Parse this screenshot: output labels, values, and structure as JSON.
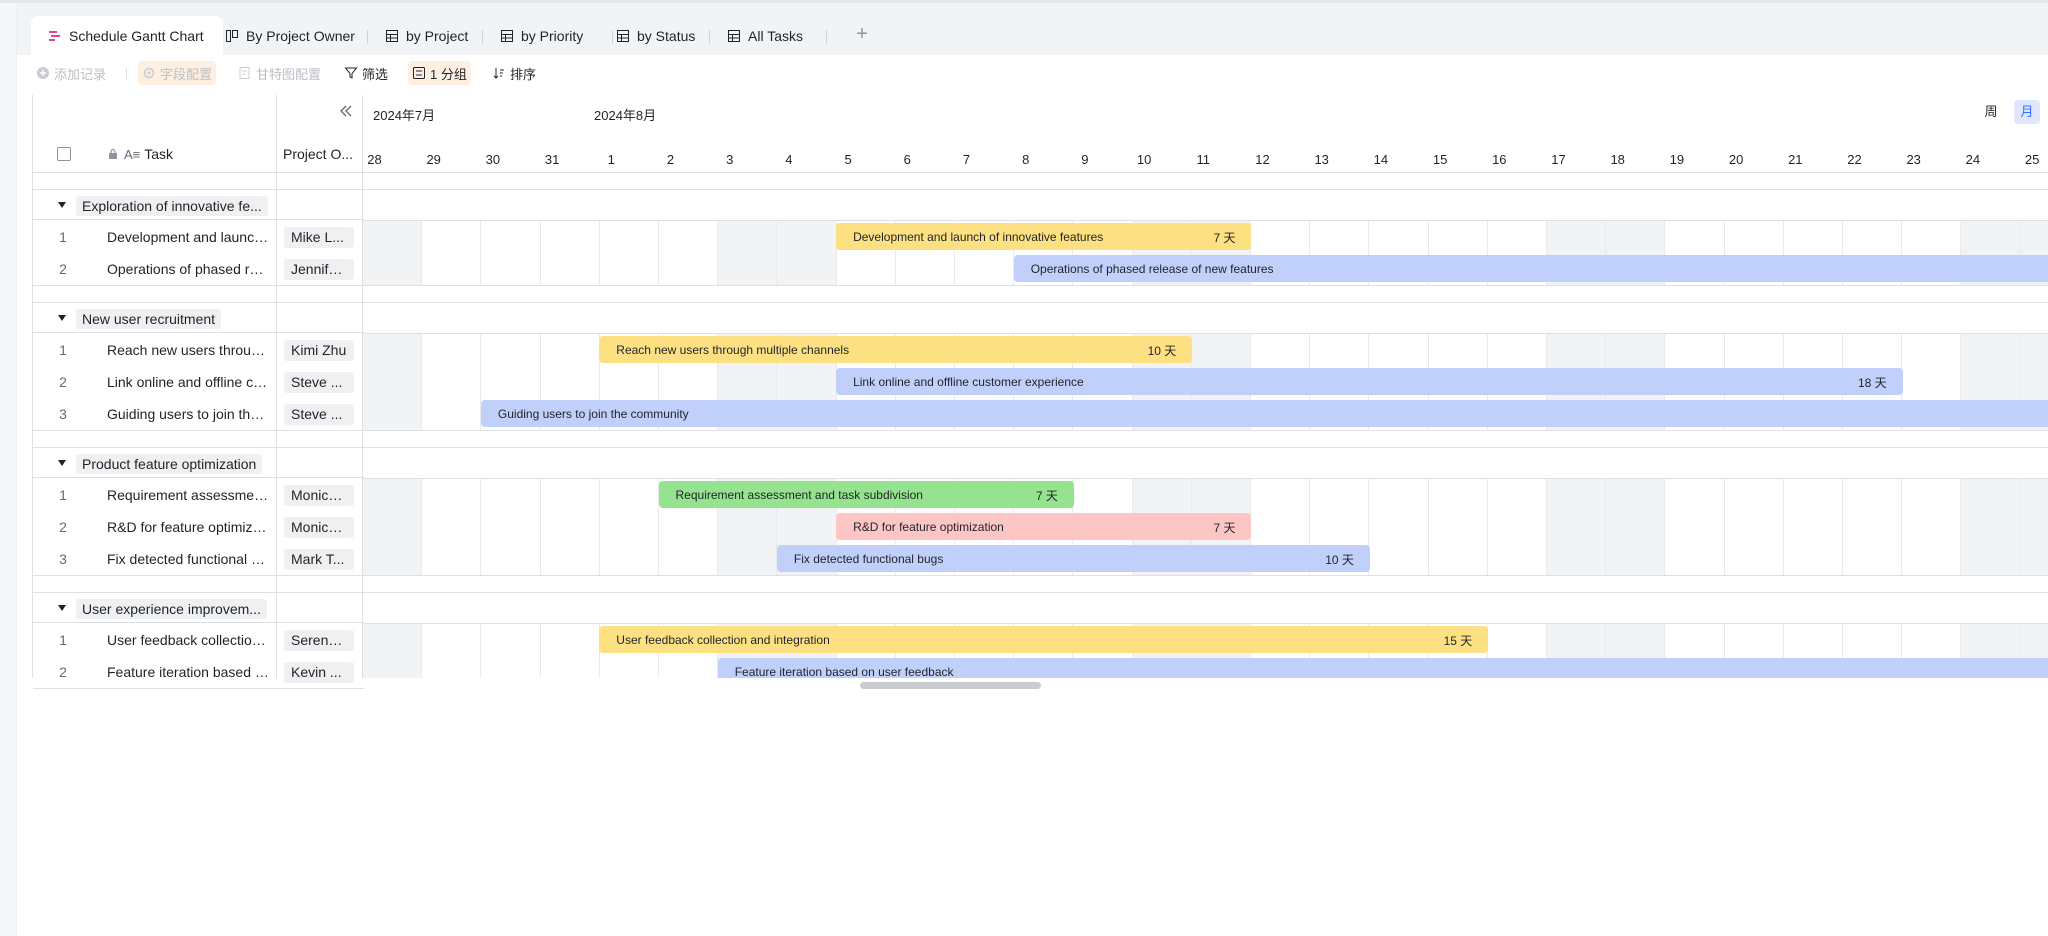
{
  "tabs": [
    {
      "label": "Schedule Gantt Chart",
      "icon": "gantt-icon",
      "active": true
    },
    {
      "label": "By Project Owner",
      "icon": "kanban-icon"
    },
    {
      "label": "by Project",
      "icon": "grid-icon"
    },
    {
      "label": "by Priority",
      "icon": "grid-icon"
    },
    {
      "label": "by Status",
      "icon": "grid-icon"
    },
    {
      "label": "All Tasks",
      "icon": "grid-icon"
    }
  ],
  "toolbar": {
    "add_record": "添加记录",
    "field_config": "字段配置",
    "gantt_config": "甘特图配置",
    "filter": "筛选",
    "group": "1 分组",
    "sort": "排序"
  },
  "columns": {
    "task": "Task",
    "owner": "Project O..."
  },
  "timeline": {
    "months": [
      "2024年7月",
      "2024年8月"
    ],
    "days": [
      "28",
      "29",
      "30",
      "31",
      "1",
      "2",
      "3",
      "4",
      "5",
      "6",
      "7",
      "8",
      "9",
      "10",
      "11",
      "12",
      "13",
      "14",
      "15",
      "16",
      "17",
      "18",
      "19",
      "20",
      "21",
      "22",
      "23",
      "24",
      "25"
    ],
    "scale_week": "周",
    "scale_month": "月"
  },
  "groups": [
    {
      "name": "Exploration of innovative fe...",
      "rows": [
        {
          "num": "1",
          "task": "Development and launch of innovative features",
          "owner": "Mike L...",
          "bar": "Development and launch of innovative features",
          "duration": "7 天",
          "color": "#fde082",
          "start": "2024-08-05",
          "end": "2024-08-11"
        },
        {
          "num": "2",
          "task": "Operations of phased release of new features",
          "owner": "Jennife...",
          "bar": "Operations of phased release of new features",
          "duration": "",
          "color": "#c1cffb",
          "start": "2024-08-08",
          "end": ""
        }
      ]
    },
    {
      "name": "New user recruitment",
      "rows": [
        {
          "num": "1",
          "task": "Reach new users through multiple channels",
          "owner": "Kimi Zhu",
          "bar": "Reach new users through multiple channels",
          "duration": "10 天",
          "color": "#fde082",
          "start": "2024-08-01",
          "end": "2024-08-10"
        },
        {
          "num": "2",
          "task": "Link online and offline customer experience",
          "owner": "Steve ...",
          "bar": "Link online and offline customer experience",
          "duration": "18 天",
          "color": "#c1cffb",
          "start": "2024-08-05",
          "end": "2024-08-22"
        },
        {
          "num": "3",
          "task": "Guiding users to join the community",
          "owner": "Steve ...",
          "bar": "Guiding users to join the community",
          "duration": "",
          "color": "#c1cffb",
          "start": "2024-07-30",
          "end": ""
        }
      ]
    },
    {
      "name": "Product feature optimization",
      "rows": [
        {
          "num": "1",
          "task": "Requirement assessment and task subdivision",
          "owner": "Monica...",
          "bar": "Requirement assessment and task subdivision",
          "duration": "7 天",
          "color": "#95e38f",
          "start": "2024-08-02",
          "end": "2024-08-08"
        },
        {
          "num": "2",
          "task": "R&D for feature optimization",
          "owner": "Monica...",
          "bar": "R&D for feature optimization",
          "duration": "7 天",
          "color": "#fdc6c4",
          "start": "2024-08-05",
          "end": "2024-08-11"
        },
        {
          "num": "3",
          "task": "Fix detected functional bugs",
          "owner": "Mark T...",
          "bar": "Fix detected functional bugs",
          "duration": "10 天",
          "color": "#c1cffb",
          "start": "2024-08-04",
          "end": "2024-08-13"
        }
      ]
    },
    {
      "name": "User experience improvem...",
      "rows": [
        {
          "num": "1",
          "task": "User feedback collection and integration",
          "owner": "Serena...",
          "bar": "User feedback collection and integration",
          "duration": "15 天",
          "color": "#fde082",
          "start": "2024-08-01",
          "end": "2024-08-15"
        },
        {
          "num": "2",
          "task": "Feature iteration based on user feedback",
          "owner": "Kevin ...",
          "bar": "Feature iteration based on user feedback",
          "duration": "",
          "color": "#c1cffb",
          "start": "2024-08-03",
          "end": ""
        }
      ]
    }
  ]
}
